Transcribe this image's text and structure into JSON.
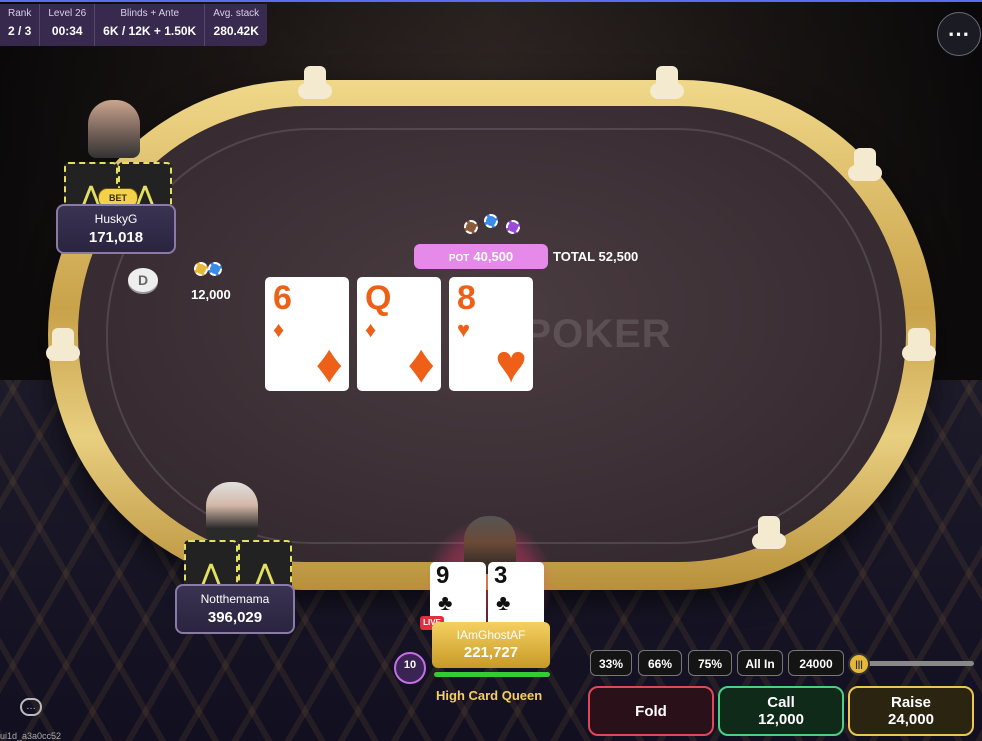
{
  "stats": [
    {
      "label": "Rank",
      "value": "2 / 3"
    },
    {
      "label": "Level 26",
      "value": "00:34"
    },
    {
      "label": "Blinds + Ante",
      "value": "6K / 12K + 1.50K"
    },
    {
      "label": "Avg. stack",
      "value": "280.42K"
    }
  ],
  "menu_icon": "⋯",
  "watermark": "M POKER",
  "players": {
    "husky": {
      "name": "HuskyG",
      "stack": "171,018",
      "bet_badge": "BET",
      "bet_amount": "12,000"
    },
    "notthemama": {
      "name": "Notthemama",
      "stack": "396,029"
    },
    "hero": {
      "name": "IAmGhostAF",
      "stack": "221,727",
      "hand": "High Card Queen",
      "live": "LIVE",
      "timer": "10"
    }
  },
  "dealer_button": "D",
  "pot": {
    "label": "POT",
    "amount": "40,500",
    "total_label": "TOTAL",
    "total": "52,500"
  },
  "board": [
    {
      "rank": "6",
      "suit": "♦"
    },
    {
      "rank": "Q",
      "suit": "♦"
    },
    {
      "rank": "8",
      "suit": "♥"
    }
  ],
  "hero_cards": [
    {
      "rank": "9",
      "suit": "♣"
    },
    {
      "rank": "3",
      "suit": "♣"
    }
  ],
  "presets": [
    "33%",
    "66%",
    "75%",
    "All In"
  ],
  "raise_input": "24000",
  "actions": {
    "fold": "Fold",
    "call_label": "Call",
    "call_amount": "12,000",
    "raise_label": "Raise",
    "raise_amount": "24,000"
  },
  "build_id": "ui1d_a3a0cc52",
  "colors": {
    "accent_orange": "#ee6018",
    "pot_pink": "#e58ae8",
    "gold": "#f4d060"
  }
}
